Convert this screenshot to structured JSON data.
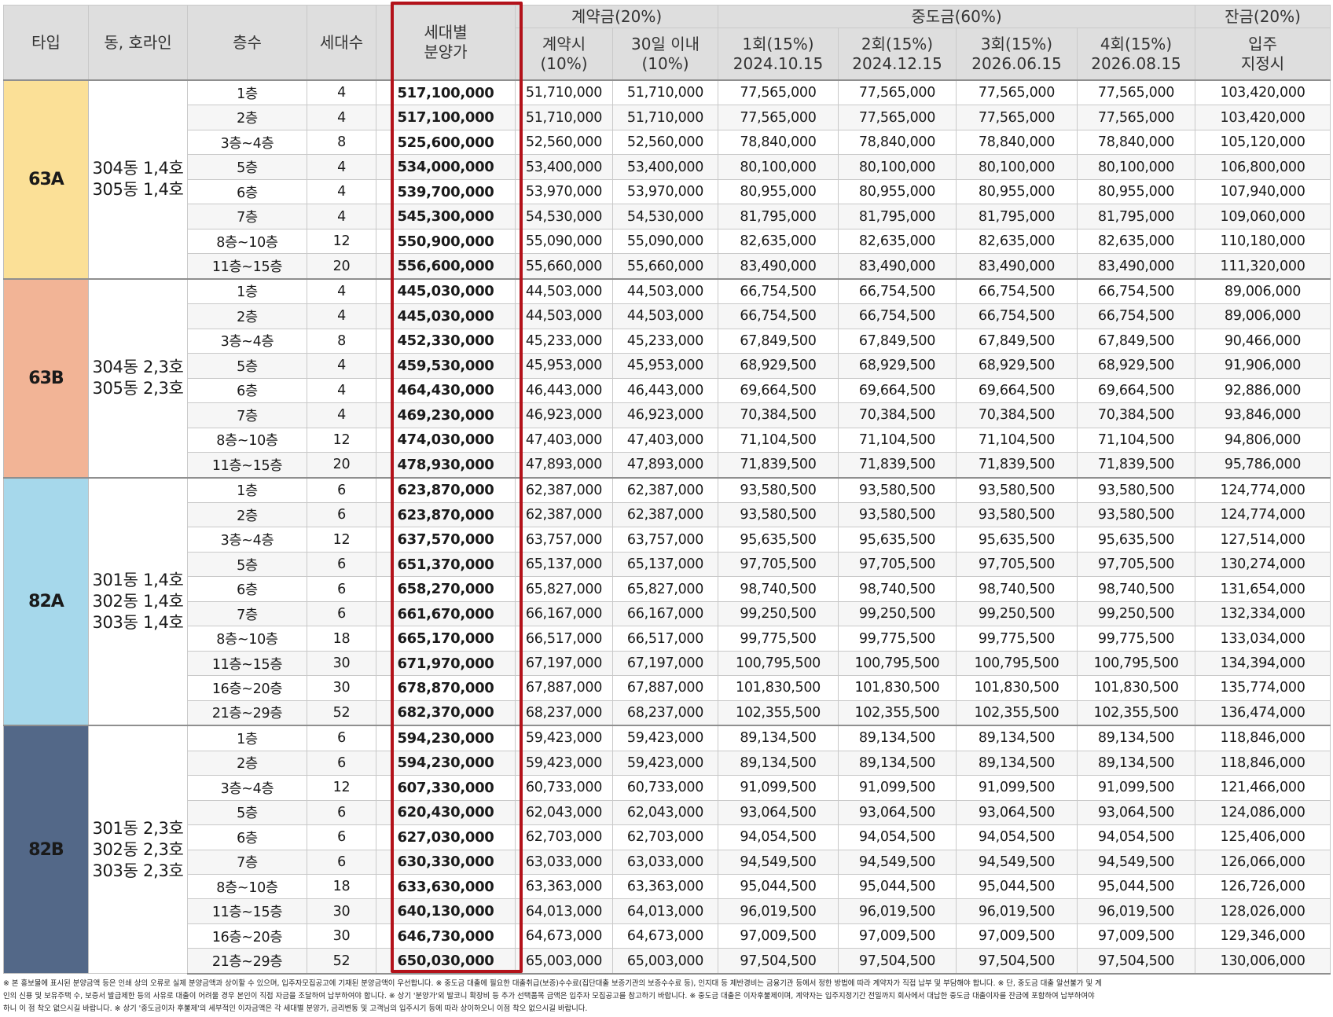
{
  "header": {
    "type": "타입",
    "dong": "동, 호라인",
    "floor": "층수",
    "units": "세대수",
    "price_line1": "세대별",
    "price_line2": "분양가",
    "contract_group": "계약금(20%)",
    "mid_group": "중도금(60%)",
    "balance_group": "잔금(20%)",
    "c1_line1": "계약시",
    "c1_line2": "(10%)",
    "c2_line1": "30일 이내",
    "c2_line2": "(10%)",
    "m1_line1": "1회(15%)",
    "m1_line2": "2024.10.15",
    "m2_line1": "2회(15%)",
    "m2_line2": "2024.12.15",
    "m3_line1": "3회(15%)",
    "m3_line2": "2026.06.15",
    "m4_line1": "4회(15%)",
    "m4_line2": "2026.08.15",
    "b_line1": "입주",
    "b_line2": "지정시"
  },
  "colors": {
    "63A": "#fbe097",
    "63B": "#f2b496",
    "82A": "#a6d8eb",
    "82B": "#536888",
    "highlight": "#b3121a"
  },
  "groups": [
    {
      "type": "63A",
      "dong": [
        "304동 1,4호",
        "305동 1,4호"
      ],
      "rows": [
        [
          "1층",
          "4",
          "517,100,000",
          "51,710,000",
          "51,710,000",
          "77,565,000",
          "77,565,000",
          "77,565,000",
          "77,565,000",
          "103,420,000"
        ],
        [
          "2층",
          "4",
          "517,100,000",
          "51,710,000",
          "51,710,000",
          "77,565,000",
          "77,565,000",
          "77,565,000",
          "77,565,000",
          "103,420,000"
        ],
        [
          "3층~4층",
          "8",
          "525,600,000",
          "52,560,000",
          "52,560,000",
          "78,840,000",
          "78,840,000",
          "78,840,000",
          "78,840,000",
          "105,120,000"
        ],
        [
          "5층",
          "4",
          "534,000,000",
          "53,400,000",
          "53,400,000",
          "80,100,000",
          "80,100,000",
          "80,100,000",
          "80,100,000",
          "106,800,000"
        ],
        [
          "6층",
          "4",
          "539,700,000",
          "53,970,000",
          "53,970,000",
          "80,955,000",
          "80,955,000",
          "80,955,000",
          "80,955,000",
          "107,940,000"
        ],
        [
          "7층",
          "4",
          "545,300,000",
          "54,530,000",
          "54,530,000",
          "81,795,000",
          "81,795,000",
          "81,795,000",
          "81,795,000",
          "109,060,000"
        ],
        [
          "8층~10층",
          "12",
          "550,900,000",
          "55,090,000",
          "55,090,000",
          "82,635,000",
          "82,635,000",
          "82,635,000",
          "82,635,000",
          "110,180,000"
        ],
        [
          "11층~15층",
          "20",
          "556,600,000",
          "55,660,000",
          "55,660,000",
          "83,490,000",
          "83,490,000",
          "83,490,000",
          "83,490,000",
          "111,320,000"
        ]
      ]
    },
    {
      "type": "63B",
      "dong": [
        "304동 2,3호",
        "305동 2,3호"
      ],
      "rows": [
        [
          "1층",
          "4",
          "445,030,000",
          "44,503,000",
          "44,503,000",
          "66,754,500",
          "66,754,500",
          "66,754,500",
          "66,754,500",
          "89,006,000"
        ],
        [
          "2층",
          "4",
          "445,030,000",
          "44,503,000",
          "44,503,000",
          "66,754,500",
          "66,754,500",
          "66,754,500",
          "66,754,500",
          "89,006,000"
        ],
        [
          "3층~4층",
          "8",
          "452,330,000",
          "45,233,000",
          "45,233,000",
          "67,849,500",
          "67,849,500",
          "67,849,500",
          "67,849,500",
          "90,466,000"
        ],
        [
          "5층",
          "4",
          "459,530,000",
          "45,953,000",
          "45,953,000",
          "68,929,500",
          "68,929,500",
          "68,929,500",
          "68,929,500",
          "91,906,000"
        ],
        [
          "6층",
          "4",
          "464,430,000",
          "46,443,000",
          "46,443,000",
          "69,664,500",
          "69,664,500",
          "69,664,500",
          "69,664,500",
          "92,886,000"
        ],
        [
          "7층",
          "4",
          "469,230,000",
          "46,923,000",
          "46,923,000",
          "70,384,500",
          "70,384,500",
          "70,384,500",
          "70,384,500",
          "93,846,000"
        ],
        [
          "8층~10층",
          "12",
          "474,030,000",
          "47,403,000",
          "47,403,000",
          "71,104,500",
          "71,104,500",
          "71,104,500",
          "71,104,500",
          "94,806,000"
        ],
        [
          "11층~15층",
          "20",
          "478,930,000",
          "47,893,000",
          "47,893,000",
          "71,839,500",
          "71,839,500",
          "71,839,500",
          "71,839,500",
          "95,786,000"
        ]
      ]
    },
    {
      "type": "82A",
      "dong": [
        "301동 1,4호",
        "302동 1,4호",
        "303동 1,4호"
      ],
      "rows": [
        [
          "1층",
          "6",
          "623,870,000",
          "62,387,000",
          "62,387,000",
          "93,580,500",
          "93,580,500",
          "93,580,500",
          "93,580,500",
          "124,774,000"
        ],
        [
          "2층",
          "6",
          "623,870,000",
          "62,387,000",
          "62,387,000",
          "93,580,500",
          "93,580,500",
          "93,580,500",
          "93,580,500",
          "124,774,000"
        ],
        [
          "3층~4층",
          "12",
          "637,570,000",
          "63,757,000",
          "63,757,000",
          "95,635,500",
          "95,635,500",
          "95,635,500",
          "95,635,500",
          "127,514,000"
        ],
        [
          "5층",
          "6",
          "651,370,000",
          "65,137,000",
          "65,137,000",
          "97,705,500",
          "97,705,500",
          "97,705,500",
          "97,705,500",
          "130,274,000"
        ],
        [
          "6층",
          "6",
          "658,270,000",
          "65,827,000",
          "65,827,000",
          "98,740,500",
          "98,740,500",
          "98,740,500",
          "98,740,500",
          "131,654,000"
        ],
        [
          "7층",
          "6",
          "661,670,000",
          "66,167,000",
          "66,167,000",
          "99,250,500",
          "99,250,500",
          "99,250,500",
          "99,250,500",
          "132,334,000"
        ],
        [
          "8층~10층",
          "18",
          "665,170,000",
          "66,517,000",
          "66,517,000",
          "99,775,500",
          "99,775,500",
          "99,775,500",
          "99,775,500",
          "133,034,000"
        ],
        [
          "11층~15층",
          "30",
          "671,970,000",
          "67,197,000",
          "67,197,000",
          "100,795,500",
          "100,795,500",
          "100,795,500",
          "100,795,500",
          "134,394,000"
        ],
        [
          "16층~20층",
          "30",
          "678,870,000",
          "67,887,000",
          "67,887,000",
          "101,830,500",
          "101,830,500",
          "101,830,500",
          "101,830,500",
          "135,774,000"
        ],
        [
          "21층~29층",
          "52",
          "682,370,000",
          "68,237,000",
          "68,237,000",
          "102,355,500",
          "102,355,500",
          "102,355,500",
          "102,355,500",
          "136,474,000"
        ]
      ]
    },
    {
      "type": "82B",
      "dong": [
        "301동 2,3호",
        "302동 2,3호",
        "303동 2,3호"
      ],
      "rows": [
        [
          "1층",
          "6",
          "594,230,000",
          "59,423,000",
          "59,423,000",
          "89,134,500",
          "89,134,500",
          "89,134,500",
          "89,134,500",
          "118,846,000"
        ],
        [
          "2층",
          "6",
          "594,230,000",
          "59,423,000",
          "59,423,000",
          "89,134,500",
          "89,134,500",
          "89,134,500",
          "89,134,500",
          "118,846,000"
        ],
        [
          "3층~4층",
          "12",
          "607,330,000",
          "60,733,000",
          "60,733,000",
          "91,099,500",
          "91,099,500",
          "91,099,500",
          "91,099,500",
          "121,466,000"
        ],
        [
          "5층",
          "6",
          "620,430,000",
          "62,043,000",
          "62,043,000",
          "93,064,500",
          "93,064,500",
          "93,064,500",
          "93,064,500",
          "124,086,000"
        ],
        [
          "6층",
          "6",
          "627,030,000",
          "62,703,000",
          "62,703,000",
          "94,054,500",
          "94,054,500",
          "94,054,500",
          "94,054,500",
          "125,406,000"
        ],
        [
          "7층",
          "6",
          "630,330,000",
          "63,033,000",
          "63,033,000",
          "94,549,500",
          "94,549,500",
          "94,549,500",
          "94,549,500",
          "126,066,000"
        ],
        [
          "8층~10층",
          "18",
          "633,630,000",
          "63,363,000",
          "63,363,000",
          "95,044,500",
          "95,044,500",
          "95,044,500",
          "95,044,500",
          "126,726,000"
        ],
        [
          "11층~15층",
          "30",
          "640,130,000",
          "64,013,000",
          "64,013,000",
          "96,019,500",
          "96,019,500",
          "96,019,500",
          "96,019,500",
          "128,026,000"
        ],
        [
          "16층~20층",
          "30",
          "646,730,000",
          "64,673,000",
          "64,673,000",
          "97,009,500",
          "97,009,500",
          "97,009,500",
          "97,009,500",
          "129,346,000"
        ],
        [
          "21층~29층",
          "52",
          "650,030,000",
          "65,003,000",
          "65,003,000",
          "97,504,500",
          "97,504,500",
          "97,504,500",
          "97,504,500",
          "130,006,000"
        ]
      ]
    }
  ],
  "notes": [
    "※ 본 홍보물에 표시된 분양금액 등은 인쇄 상의 오류로 실제 분양금액과 상이할 수 있으며, 입주자모집공고에 기재된 분양금액이 우선합니다. ※ 중도금 대출에 필요한 대출취급(보증)수수료(집단대출 보증기관의 보증수수료 등), 인지대 등 제반경비는 금융기관 등에서 정한 방법에 따라 계약자가 직접 납부 및 부담해야 합니다. ※ 단, 중도금 대출 알선불가 및 계",
    "인의 신용 및 보유주택 수, 보증서 발급제한 등의 사유로 대출이 어려울 경우 본인이 직접 자금을 조달하여 납부하여야 합니다. ※ 상기 '분양가'외 발코니 확장비 등 추가 선택품목 금액은 입주자 모집공고를 참고하기 바랍니다. ※ 중도금 대출은 이자후불제이며, 계약자는 입주지정기간 전일까지 회사에서 대납한 중도금 대출이자를 잔금에 포함하여 납부하여야",
    "하니 이 점 착오 없으시길 바랍니다. ※ 상기 '중도금이자 후불제'의 세부적인 이자금액은 각 세대별 분양가, 금리변동 및 고객님의 입주시기 등에 따라 상이하오니 이점 착오 없으시길 바랍니다."
  ]
}
